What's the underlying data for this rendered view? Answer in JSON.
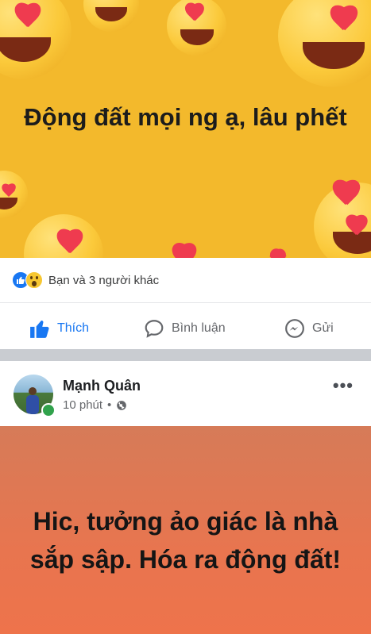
{
  "post1": {
    "text": "Động đất mọi ng ạ, lâu phết",
    "background_color": "#f3b92c",
    "decoration": "love-emoji-pattern"
  },
  "reactions": {
    "icons": [
      "like-icon",
      "wow-icon"
    ],
    "summary": "Bạn và 3 người khác"
  },
  "actions": {
    "like_label": "Thích",
    "comment_label": "Bình luận",
    "send_label": "Gửi",
    "like_color": "#1877f2"
  },
  "post2": {
    "author": "Mạnh Quân",
    "time": "10 phút",
    "privacy_icon": "globe-icon",
    "more_label": "•••",
    "text": "Hic, tưởng ảo giác là nhà sắp sập. Hóa ra động đất!",
    "background_color": "#e8754f",
    "online_color": "#31a24c"
  }
}
